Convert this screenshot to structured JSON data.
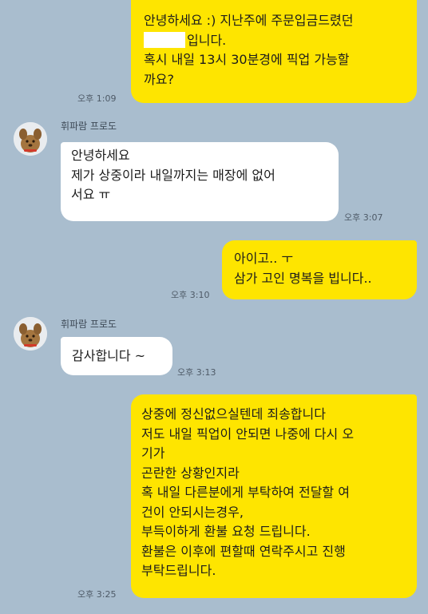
{
  "chat": {
    "messages": [
      {
        "from": "me",
        "line1": "안녕하세요 :) 지난주에 주문입금드렸던",
        "line2_suffix": "입니다.",
        "line3": "혹시 내일 13시 30분경에 픽업 가능할",
        "line4": "까요?",
        "time": "오후 1:09"
      },
      {
        "from": "them",
        "sender": "휘파람 프로도",
        "text": "안녕하세요\n제가 상중이라 내일까지는 매장에 없어\n서요 ㅠ",
        "time": "오후 3:07"
      },
      {
        "from": "me",
        "text": "아이고.. ㅜ\n삼가 고인 명복을 빕니다..",
        "time": "오후 3:10"
      },
      {
        "from": "them",
        "sender": "휘파람 프로도",
        "text": "감사합니다 ~",
        "time": "오후 3:13"
      },
      {
        "from": "me",
        "text": "상중에 정신없으실텐데 죄송합니다\n저도 내일 픽업이 안되면 나중에 다시 오\n기가\n곤란한 상황인지라\n혹 내일 다른분에게 부탁하여 전달할 여\n건이 안되시는경우,\n부득이하게 환불 요청 드립니다.\n환불은 이후에 편할때 연락주시고 진행\n부탁드립니다.",
        "time": "오후 3:25"
      }
    ]
  },
  "colors": {
    "background": "#a9bdce",
    "my_bubble": "#fee500",
    "their_bubble": "#ffffff"
  },
  "icons": {
    "avatar": "brown-dog-character-avatar",
    "expand": "expand-arrows-icon"
  }
}
